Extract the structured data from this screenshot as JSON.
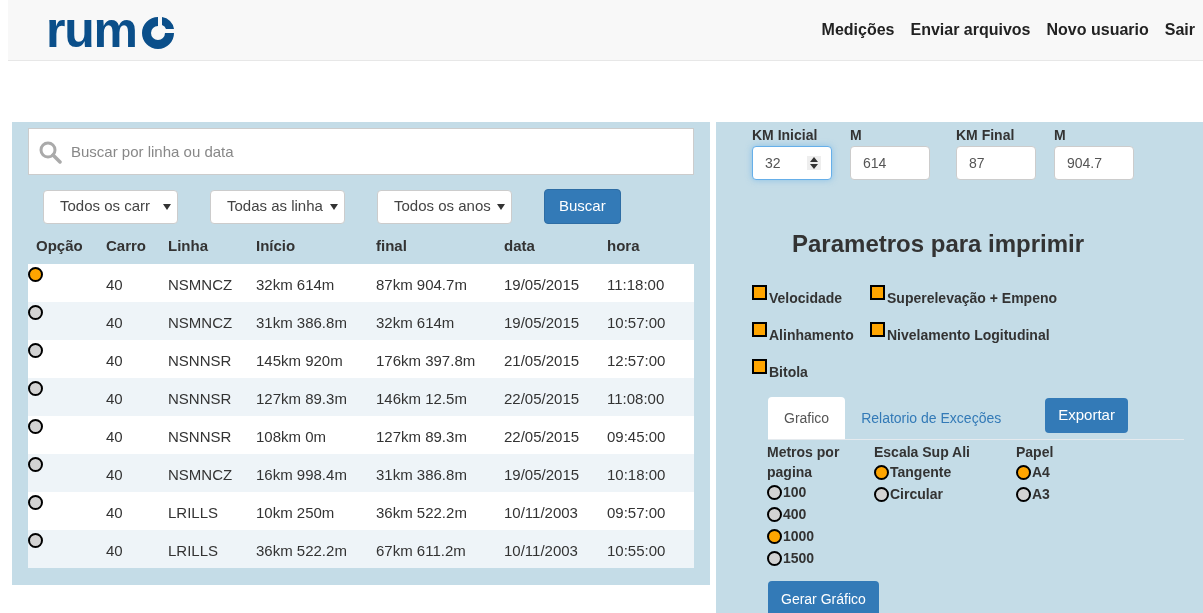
{
  "header": {
    "logo_text": "rum",
    "nav": [
      "Medições",
      "Enviar arquivos",
      "Novo usuario",
      "Sair"
    ]
  },
  "search": {
    "placeholder": "Buscar por linha ou data"
  },
  "filters": [
    "Todos os carr",
    "Todas as linha",
    "Todos os anos"
  ],
  "search_button": "Buscar",
  "table": {
    "columns": [
      "Opção",
      "Carro",
      "Linha",
      "Início",
      "final",
      "data",
      "hora"
    ],
    "rows": [
      {
        "selected": true,
        "cells": [
          "",
          "40",
          "NSMNCZ",
          "32km 614m",
          "87km 904.7m",
          "19/05/2015",
          "11:18:00"
        ]
      },
      {
        "selected": false,
        "cells": [
          "",
          "40",
          "NSMNCZ",
          "31km 386.8m",
          "32km 614m",
          "19/05/2015",
          "10:57:00"
        ]
      },
      {
        "selected": false,
        "cells": [
          "",
          "40",
          "NSNNSR",
          "145km 920m",
          "176km 397.8m",
          "21/05/2015",
          "12:57:00"
        ]
      },
      {
        "selected": false,
        "cells": [
          "",
          "40",
          "NSNNSR",
          "127km 89.3m",
          "146km 12.5m",
          "22/05/2015",
          "11:08:00"
        ]
      },
      {
        "selected": false,
        "cells": [
          "",
          "40",
          "NSNNSR",
          "108km 0m",
          "127km 89.3m",
          "22/05/2015",
          "09:45:00"
        ]
      },
      {
        "selected": false,
        "cells": [
          "",
          "40",
          "NSMNCZ",
          "16km 998.4m",
          "31km 386.8m",
          "19/05/2015",
          "10:18:00"
        ]
      },
      {
        "selected": false,
        "cells": [
          "",
          "40",
          "LRILLS",
          "10km 250m",
          "36km 522.2m",
          "10/11/2003",
          "09:57:00"
        ]
      },
      {
        "selected": false,
        "cells": [
          "",
          "40",
          "LRILLS",
          "36km 522.2m",
          "67km 611.2m",
          "10/11/2003",
          "10:55:00"
        ]
      }
    ]
  },
  "range": [
    {
      "label": "KM Inicial",
      "value": "32",
      "kind": "spinner"
    },
    {
      "label": "M",
      "value": "614",
      "kind": "text"
    },
    {
      "label": "KM Final",
      "value": "87",
      "kind": "text"
    },
    {
      "label": "M",
      "value": "904.7",
      "kind": "text"
    }
  ],
  "print_title": "Parametros para imprimir",
  "options": [
    {
      "label": "Velocidade",
      "checked": true
    },
    {
      "label": "Superelevação + Empeno",
      "checked": true
    },
    {
      "label": "Alinhamento",
      "checked": true
    },
    {
      "label": "Nivelamento Logitudinal",
      "checked": true
    },
    {
      "label": "Bitola",
      "checked": true
    }
  ],
  "tabs": [
    {
      "label": "Grafico",
      "selected": true
    },
    {
      "label": "Relatorio de Exceções",
      "selected": false
    }
  ],
  "export_button": "Exportar",
  "radio_groups": [
    {
      "title": "Metros por pagina",
      "options": [
        {
          "label": "100",
          "selected": false
        },
        {
          "label": "400",
          "selected": false
        },
        {
          "label": "1000",
          "selected": true
        },
        {
          "label": "1500",
          "selected": false
        }
      ]
    },
    {
      "title": "Escala Sup Ali",
      "options": [
        {
          "label": "Tangente",
          "selected": true
        },
        {
          "label": "Circular",
          "selected": false
        }
      ]
    },
    {
      "title": "Papel",
      "options": [
        {
          "label": "A4",
          "selected": true
        },
        {
          "label": "A3",
          "selected": false
        }
      ]
    }
  ],
  "generate_button": "Gerar Gráfico"
}
